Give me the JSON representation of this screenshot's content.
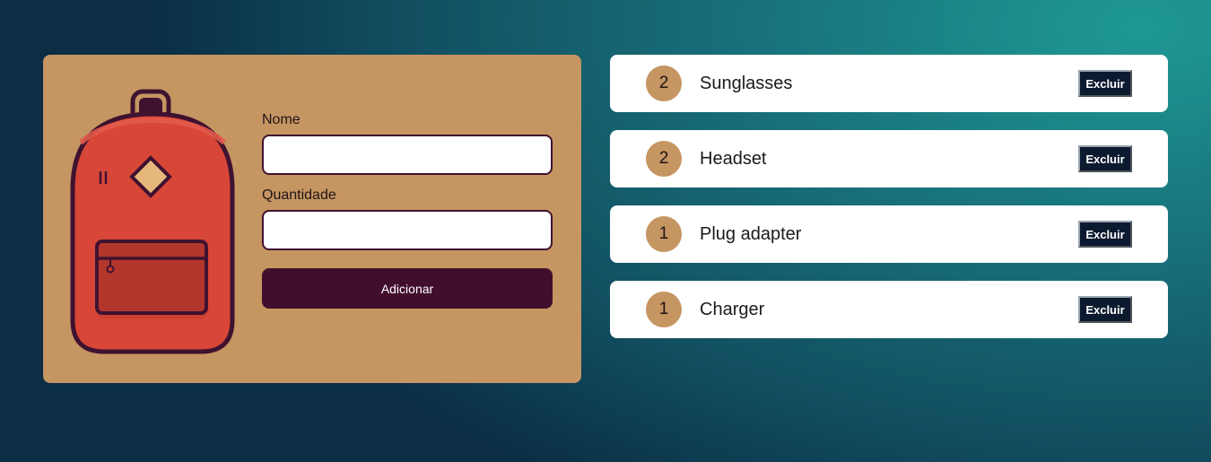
{
  "colors": {
    "card_background": "#c59562",
    "primary_button": "#410f2d",
    "delete_button": "#0c1a2f",
    "backpack_red": "#d84637"
  },
  "form": {
    "name_label": "Nome",
    "name_value": "",
    "quantity_label": "Quantidade",
    "quantity_value": "",
    "submit_label": "Adicionar"
  },
  "items": [
    {
      "quantity": "2",
      "name": "Sunglasses",
      "delete_label": "Excluir"
    },
    {
      "quantity": "2",
      "name": "Headset",
      "delete_label": "Excluir"
    },
    {
      "quantity": "1",
      "name": "Plug adapter",
      "delete_label": "Excluir"
    },
    {
      "quantity": "1",
      "name": "Charger",
      "delete_label": "Excluir"
    }
  ]
}
